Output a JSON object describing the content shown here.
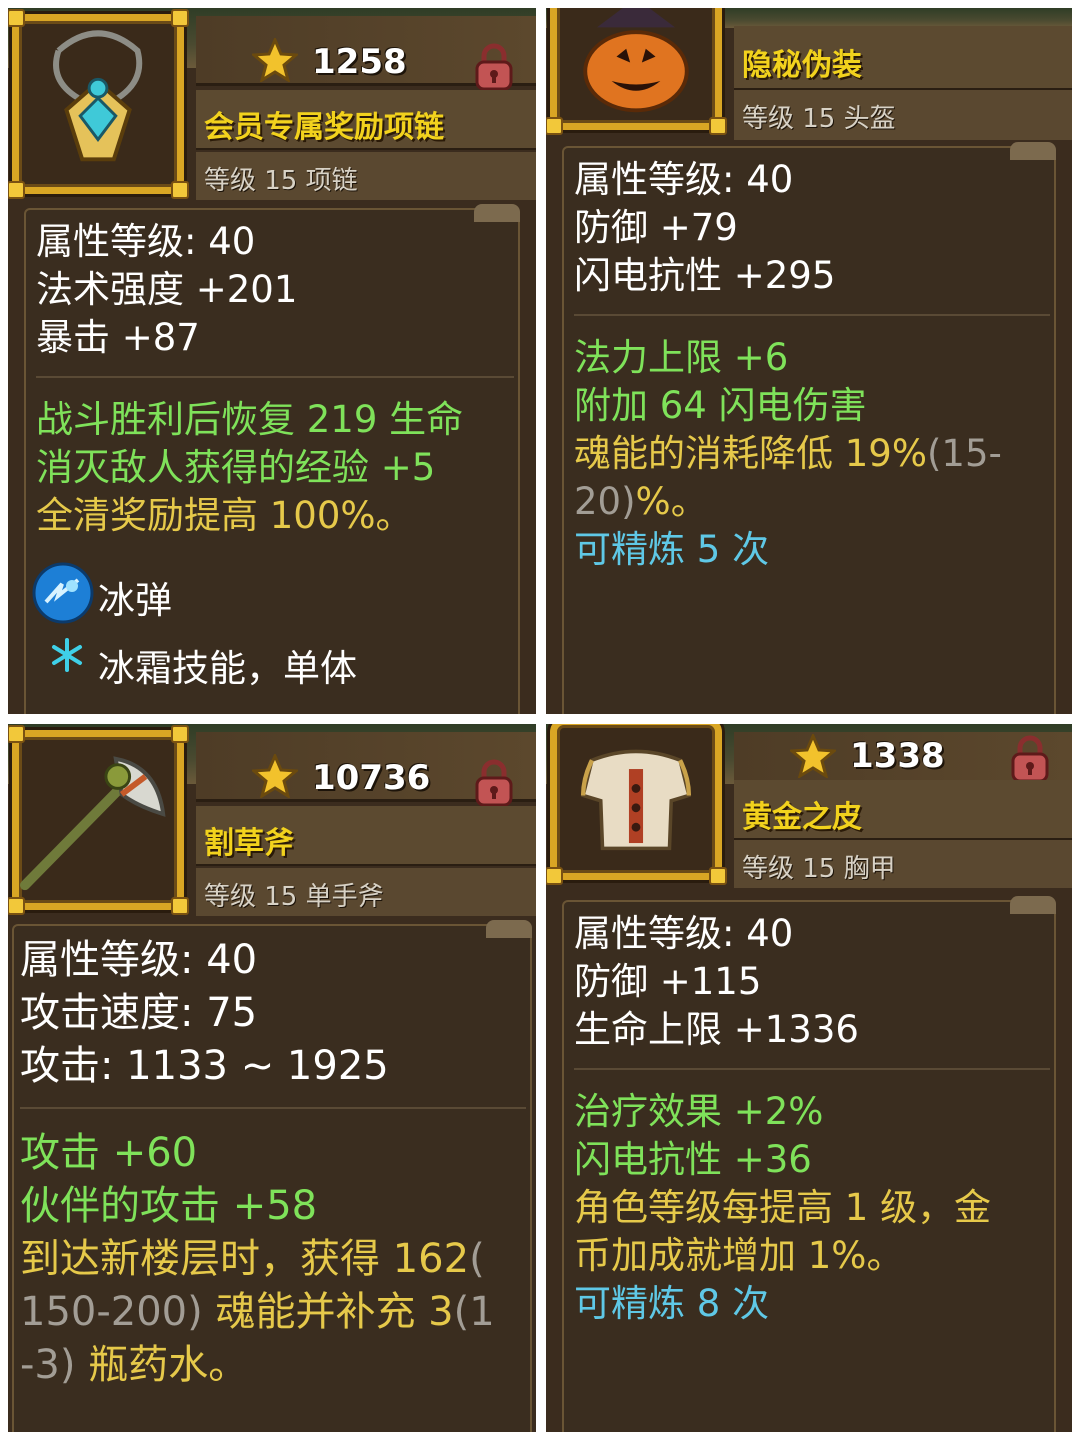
{
  "cards": [
    {
      "score": "1258",
      "name": "会员专属奖励项链",
      "type": "等级 15 项链",
      "icon": "necklace-icon",
      "base_stats": [
        "属性等级: 40",
        "法术强度 +201",
        "暴击 +87"
      ],
      "bonus_stats": [
        "战斗胜利后恢复 219 生命",
        "消灭敌人获得的经验 +5"
      ],
      "gold_stats": [
        "全清奖励提高 100%。"
      ],
      "skill": {
        "icon": "ice-bolt-icon",
        "name": "冰弹",
        "desc_icon": "snowflake-icon",
        "desc": "冰霜技能，单体"
      }
    },
    {
      "name": "隐秘伪装",
      "type": "等级 15 头盔",
      "icon": "pumpkin-helmet-icon",
      "base_stats": [
        "属性等级: 40",
        "防御 +79",
        "闪电抗性 +295"
      ],
      "bonus_stats": [
        "法力上限 +6",
        "附加 64 闪电伤害"
      ],
      "mixed_line_1": {
        "gold": "魂能的消耗降低 19%",
        "gray": "(15-"
      },
      "mixed_line_2": {
        "gray": "20)",
        "gold": "%。"
      },
      "refine": "可精炼 5 次"
    },
    {
      "score": "10736",
      "name": "割草斧",
      "type": "等级 15 单手斧",
      "icon": "axe-icon",
      "base_stats": [
        "属性等级: 40",
        "攻击速度: 75",
        "攻击: 1133 ~ 1925"
      ],
      "bonus_stats": [
        "攻击 +60",
        "伙伴的攻击 +58"
      ],
      "mixed_line_1": {
        "gold": "到达新楼层时，获得 162",
        "gray": "("
      },
      "mixed_line_2": {
        "gray": "150-200)",
        "gold": " 魂能并补充 3",
        "gray2": "(1"
      },
      "mixed_line_3": {
        "gray": "-3)",
        "gold": " 瓶药水。"
      }
    },
    {
      "score": "1338",
      "name": "黄金之皮",
      "type": "等级 15 胸甲",
      "icon": "chest-armor-icon",
      "base_stats": [
        "属性等级: 40",
        "防御 +115",
        "生命上限 +1336"
      ],
      "bonus_stats": [
        "治疗效果 +2%",
        "闪电抗性 +36"
      ],
      "gold_stats": [
        "角色等级每提高 1 级，金",
        "币加成就增加 1%。"
      ],
      "refine": "可精炼 8 次"
    }
  ],
  "colors": {
    "name": "#f2d21d",
    "base": "#ffffff",
    "bonus": "#7fe25a",
    "special": "#e6c94a",
    "range": "#a29d95",
    "refine": "#5fc8e6",
    "frame": "#d9a624"
  }
}
